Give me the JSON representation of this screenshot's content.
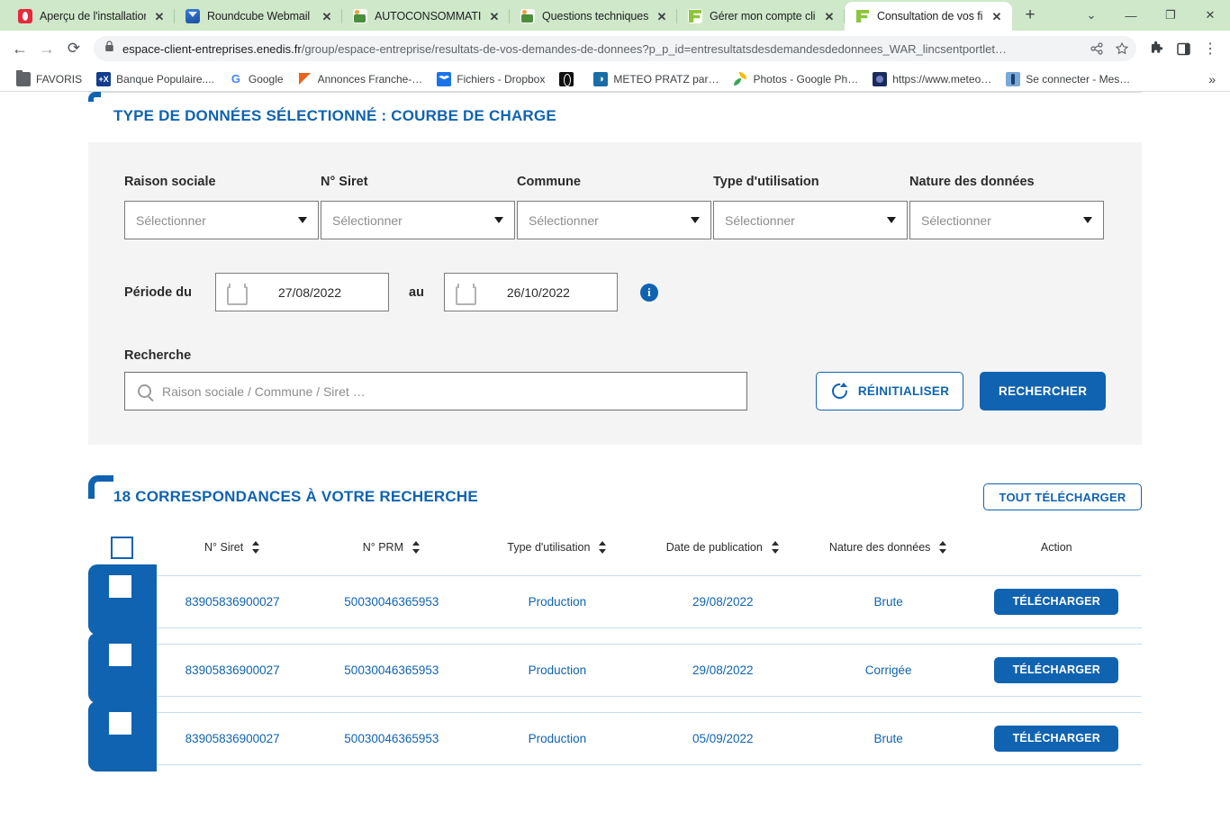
{
  "browser": {
    "tabs": [
      {
        "title": "Aperçu de l'installation",
        "favicon": "opera-icon",
        "active": false
      },
      {
        "title": "Roundcube Webmail ::",
        "favicon": "roundcube-icon",
        "active": false
      },
      {
        "title": "AUTOCONSOMMATION",
        "favicon": "sprite-icon",
        "active": false
      },
      {
        "title": "Questions techniques",
        "favicon": "sprite-icon",
        "active": false
      },
      {
        "title": "Gérer mon compte clien",
        "favicon": "enedis-icon",
        "active": false
      },
      {
        "title": "Consultation de vos fic",
        "favicon": "enedis-icon",
        "active": true
      }
    ],
    "new_tab_label": "+",
    "tab_search_label": "⌄",
    "window_controls": {
      "minimize": "—",
      "maximize": "❐",
      "close": "✕"
    },
    "nav": {
      "back": "←",
      "forward": "→",
      "reload": "⟳"
    },
    "omnibox": {
      "lock": "lock-icon",
      "url_domain": "espace-client-entreprises.enedis.fr",
      "url_path": "/group/espace-entreprise/resultats-de-vos-demandes-de-donnees?p_p_id=entresultatsdesdemandesdedonnees_WAR_lincsentportlet…",
      "share": "share-icon",
      "bookmark": "star-icon"
    },
    "toolbar_right": {
      "extensions": "puzzle-icon",
      "sidepanel": "side-panel-icon",
      "menu": "⋮"
    },
    "bookmarks": [
      {
        "label": "FAVORIS",
        "icon": "folder-icon"
      },
      {
        "label": "Banque Populaire....",
        "icon": "banque-populaire-icon"
      },
      {
        "label": "Google",
        "icon": "google-icon"
      },
      {
        "label": "Annonces Franche-…",
        "icon": "annonces-icon"
      },
      {
        "label": "Fichiers - Dropbox",
        "icon": "dropbox-icon"
      },
      {
        "label": "",
        "icon": "globe-icon"
      },
      {
        "label": "METEO PRATZ par…",
        "icon": "meteo-icon"
      },
      {
        "label": "Photos - Google Ph…",
        "icon": "google-photos-icon"
      },
      {
        "label": "https://www.meteo…",
        "icon": "meteo-blue-icon"
      },
      {
        "label": "Se connecter - Mes…",
        "icon": "se-connecter-icon"
      }
    ],
    "bookmarks_overflow": "»"
  },
  "panel": {
    "title": "TYPE DE DONNÉES SÉLECTIONNÉ : COURBE DE CHARGE"
  },
  "filters": [
    {
      "label": "Raison sociale",
      "value": "Sélectionner"
    },
    {
      "label": "N° Siret",
      "value": "Sélectionner"
    },
    {
      "label": "Commune",
      "value": "Sélectionner"
    },
    {
      "label": "Type d'utilisation",
      "value": "Sélectionner"
    },
    {
      "label": "Nature des données",
      "value": "Sélectionner"
    }
  ],
  "period": {
    "label": "Période du",
    "from": "27/08/2022",
    "separator": "au",
    "to": "26/10/2022",
    "info": "i"
  },
  "search": {
    "label": "Recherche",
    "placeholder": "Raison sociale / Commune / Siret …",
    "value": "",
    "reset_label": "RÉINITIALISER",
    "submit_label": "RECHERCHER"
  },
  "results": {
    "title": "18 CORRESPONDANCES À VOTRE RECHERCHE",
    "count": 18,
    "download_all_label": "TOUT TÉLÉCHARGER",
    "columns": [
      {
        "label": "",
        "sortable": false
      },
      {
        "label": "N° Siret",
        "sortable": true
      },
      {
        "label": "N° PRM",
        "sortable": true
      },
      {
        "label": "Type d'utilisation",
        "sortable": true
      },
      {
        "label": "Date de publication",
        "sortable": true
      },
      {
        "label": "Nature des données",
        "sortable": true
      },
      {
        "label": "Action",
        "sortable": false
      }
    ],
    "download_label": "TÉLÉCHARGER",
    "rows": [
      {
        "siret": "83905836900027",
        "prm": "50030046365953",
        "type": "Production",
        "date": "29/08/2022",
        "nature": "Brute",
        "checked": false
      },
      {
        "siret": "83905836900027",
        "prm": "50030046365953",
        "type": "Production",
        "date": "29/08/2022",
        "nature": "Corrigée",
        "checked": false
      },
      {
        "siret": "83905836900027",
        "prm": "50030046365953",
        "type": "Production",
        "date": "05/09/2022",
        "nature": "Brute",
        "checked": false
      }
    ]
  },
  "colors": {
    "brand_blue": "#1063b0",
    "panel_grey": "#f4f4f4",
    "tabstrip_green": "#cfe8c9",
    "row_border": "#c8ddf0"
  }
}
